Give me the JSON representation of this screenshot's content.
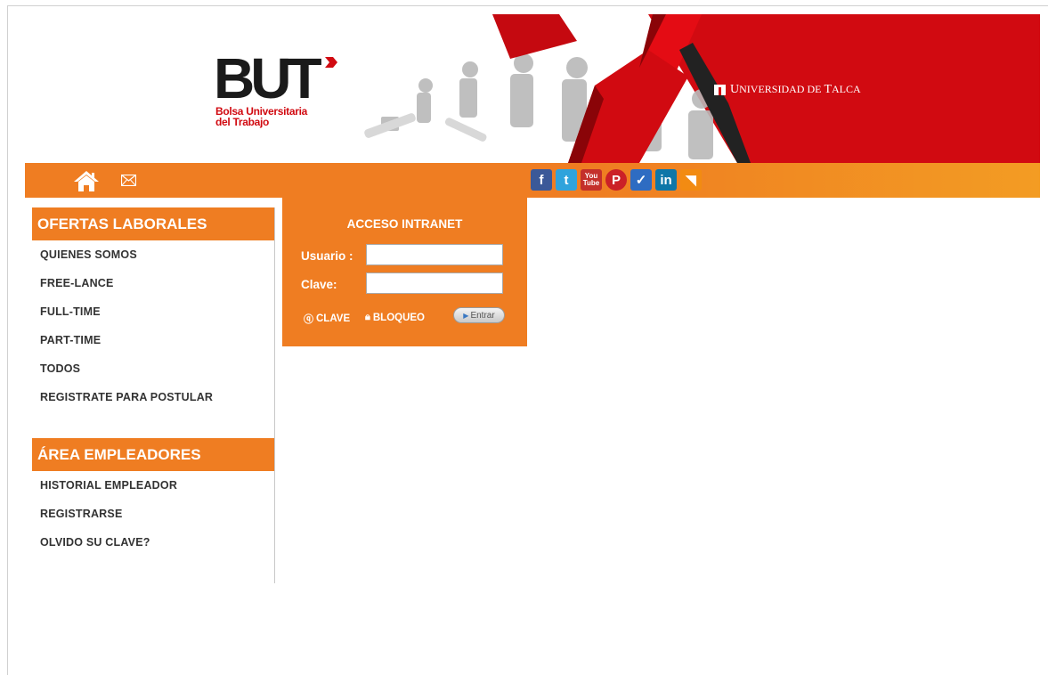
{
  "header": {
    "logo_text": "BUT",
    "logo_subtitle_line1": "Bolsa Universitaria",
    "logo_subtitle_line2": "del Trabajo",
    "university_name_initial1": "U",
    "university_name_rest1": "NIVERSIDAD DE ",
    "university_name_initial2": "T",
    "university_name_rest2": "ALCA",
    "brand_red": "#d10a11"
  },
  "navbar": {
    "color": "#ef7d22",
    "icons": [
      "home-icon",
      "mail-icon"
    ],
    "social": [
      {
        "name": "facebook-icon",
        "glyph": "f"
      },
      {
        "name": "twitter-icon",
        "glyph": "t"
      },
      {
        "name": "youtube-icon",
        "glyph_top": "You",
        "glyph_bottom": "Tube"
      },
      {
        "name": "pinterest-icon",
        "glyph": "P"
      },
      {
        "name": "delicious-icon",
        "glyph": "✓"
      },
      {
        "name": "linkedin-icon",
        "glyph": "in"
      },
      {
        "name": "rss-icon",
        "glyph": "◥"
      }
    ]
  },
  "sidebar": {
    "section1_title": "OFERTAS LABORALES",
    "section1_items": [
      "QUIENES SOMOS",
      "FREE-LANCE",
      "FULL-TIME",
      "PART-TIME",
      "TODOS",
      "REGISTRATE PARA POSTULAR"
    ],
    "section2_title": "ÁREA EMPLEADORES",
    "section2_items": [
      "HISTORIAL EMPLEADOR",
      "REGISTRARSE",
      "OLVIDO SU CLAVE?"
    ]
  },
  "login": {
    "title": "ACCESO INTRANET",
    "user_label": "Usuario :",
    "user_value": "",
    "password_label": "Clave:",
    "password_value": "",
    "forgot_label": "CLAVE",
    "lock_label": "BLOQUEO",
    "submit_label": "Entrar"
  }
}
